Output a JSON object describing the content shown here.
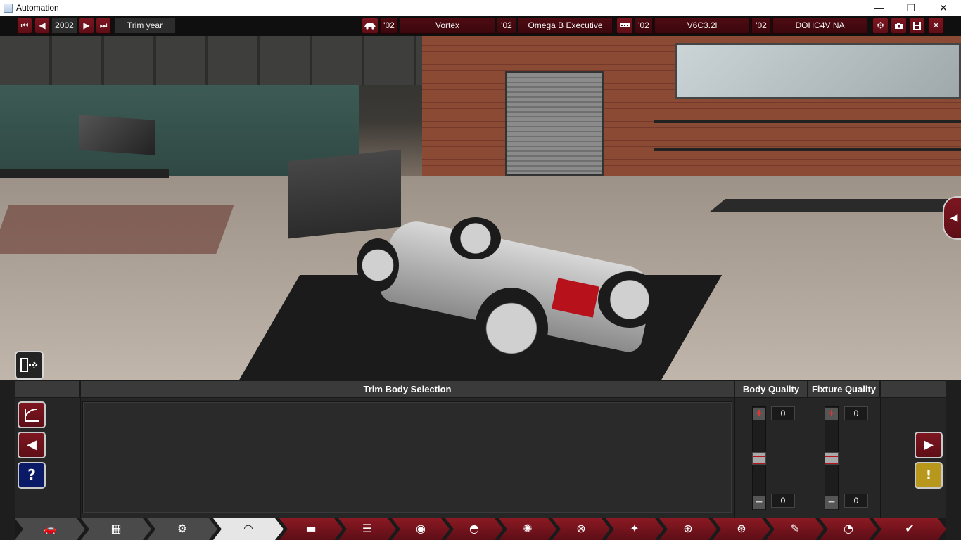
{
  "window": {
    "title": "Automation",
    "minimize": "—",
    "maximize": "❐",
    "close": "✕"
  },
  "topbar": {
    "first_icon": "⏮",
    "prev_icon": "◀",
    "year": "2002",
    "next_icon": "▶",
    "last_icon": "⏭",
    "trim_year_label": "Trim year",
    "car_icon": "car-icon",
    "model_year": "'02",
    "model": "Vortex",
    "trim_year": "'02",
    "trim": "Omega B Executive",
    "engine_icon": "engine-icon",
    "family_year": "'02",
    "family": "V6C3.2l",
    "variant_year": "'02",
    "variant": "DOHC4V NA",
    "settings_icon": "⚙",
    "camera_icon": "📷",
    "save_icon": "💾",
    "close_icon": "✕"
  },
  "scene": {
    "side_tab_icon": "◀",
    "exit_icon": "⇥"
  },
  "panel": {
    "header_trim": "Trim Body Selection",
    "header_body_quality": "Body Quality",
    "header_fixture_quality": "Fixture Quality",
    "body_quality": {
      "top_value": "0",
      "bottom_value": "0",
      "plus": "+",
      "minus": "−"
    },
    "fixture_quality": {
      "top_value": "0",
      "bottom_value": "0",
      "plus": "+",
      "minus": "−"
    },
    "curve_icon": "⌐",
    "back_icon": "◀",
    "help_icon": "?",
    "next_icon": "▶",
    "warning_icon": "!"
  },
  "tabs": [
    {
      "icon": "🚗",
      "name": "car-icon"
    },
    {
      "icon": "▦",
      "name": "chassis-icon"
    },
    {
      "icon": "⚙",
      "name": "suspension-icon"
    },
    {
      "icon": "◠",
      "name": "body-icon"
    },
    {
      "icon": "▬",
      "name": "trim-icon"
    },
    {
      "icon": "☰",
      "name": "interior-icon"
    },
    {
      "icon": "◉",
      "name": "lights-icon"
    },
    {
      "icon": "◓",
      "name": "aero-icon"
    },
    {
      "icon": "✺",
      "name": "wheels-icon"
    },
    {
      "icon": "⊗",
      "name": "brakes-icon"
    },
    {
      "icon": "✦",
      "name": "fixtures-icon"
    },
    {
      "icon": "⊕",
      "name": "drivetrain-icon"
    },
    {
      "icon": "⊛",
      "name": "steering-icon"
    },
    {
      "icon": "✎",
      "name": "paint-icon"
    },
    {
      "icon": "◔",
      "name": "test-icon"
    },
    {
      "icon": "✔",
      "name": "finish-icon"
    }
  ]
}
